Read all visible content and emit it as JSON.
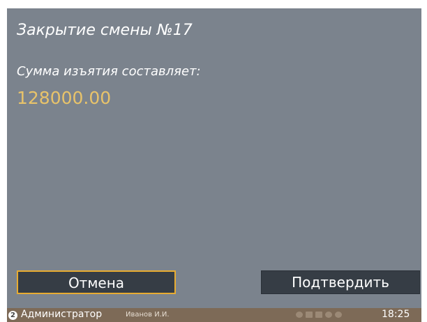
{
  "screen": {
    "title": "Закрытие смены №17",
    "prompt": "Сумма изъятия составляет:",
    "amount": "128000.00"
  },
  "buttons": {
    "cancel_label": "Отмена",
    "confirm_label": "Подтвердить"
  },
  "status_bar": {
    "role_number": "2",
    "role": "Администратор",
    "user": "Иванов И.И.",
    "tray_icons": [
      "lock-icon",
      "keyboard-icon",
      "printer-icon",
      "link-icon",
      "network-icon"
    ],
    "time": "18:25"
  },
  "colors": {
    "background": "#7b838d",
    "amount": "#e8c36a",
    "button": "#363d45",
    "focus_border": "#e8ac31",
    "status_bar": "#7d6a57"
  }
}
